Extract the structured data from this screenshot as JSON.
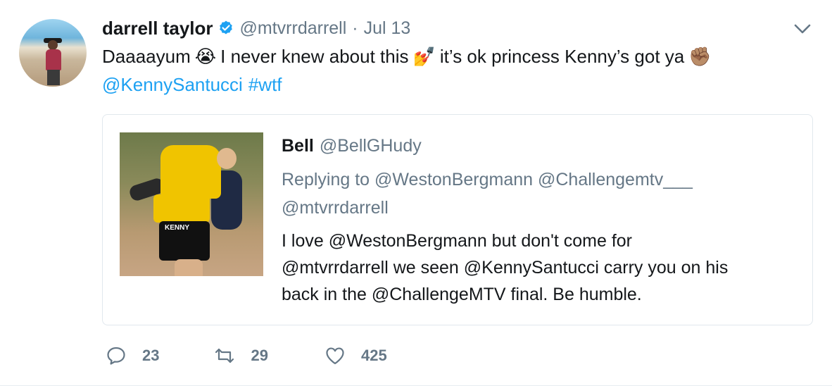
{
  "tweet": {
    "author_name": "darrell taylor",
    "author_handle": "@mtvrrdarrell",
    "separator": "·",
    "date": "Jul 13",
    "text_part1": "Daaaayum",
    "emoji1": "😭",
    "text_part2": "I never knew about this",
    "emoji2": "💅",
    "text_part3": "it’s ok princess Kenny’s got ya",
    "emoji3": "✊🏽",
    "mention": "@KennySantucci",
    "hashtag": "#wtf"
  },
  "quote": {
    "author_name": "Bell",
    "author_handle": "@BellGHudy",
    "replying_line1": "Replying to @WestonBergmann @Challengemtv___",
    "replying_line2": "@mtvrrdarrell",
    "text_line1": "I love @WestonBergmann but don't come for",
    "text_line2": "@mtvrrdarrell we seen @KennySantucci carry you on his",
    "text_line3": "back in the @ChallengeMTV final. Be humble.",
    "photo_label": "KENNY"
  },
  "actions": {
    "replies": "23",
    "retweets": "29",
    "likes": "425"
  },
  "colors": {
    "link": "#1da1f2",
    "secondary": "#657786",
    "verified": "#1da1f2",
    "border": "#e1e8ed"
  },
  "icons": [
    "verified-badge-icon",
    "chevron-down-icon",
    "reply-icon",
    "retweet-icon",
    "like-icon"
  ]
}
